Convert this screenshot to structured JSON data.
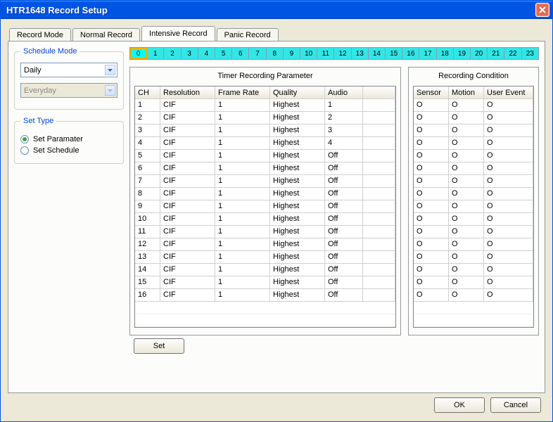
{
  "window": {
    "title": "HTR1648 Record Setup"
  },
  "tabs": [
    {
      "label": "Record Mode"
    },
    {
      "label": "Normal Record"
    },
    {
      "label": "Intensive Record"
    },
    {
      "label": "Panic Record"
    }
  ],
  "active_tab": 2,
  "schedule_mode": {
    "legend": "Schedule Mode",
    "primary_value": "Daily",
    "secondary_value": "Everyday",
    "secondary_disabled": true
  },
  "set_type": {
    "legend": "Set Type",
    "options": [
      {
        "label": "Set Paramater",
        "checked": true
      },
      {
        "label": "Set Schedule",
        "checked": false
      }
    ]
  },
  "hours": [
    "0",
    "1",
    "2",
    "3",
    "4",
    "5",
    "6",
    "7",
    "8",
    "9",
    "10",
    "11",
    "12",
    "13",
    "14",
    "15",
    "16",
    "17",
    "18",
    "19",
    "20",
    "21",
    "22",
    "23"
  ],
  "selected_hour": 0,
  "main_table": {
    "caption": "Timer Recording Parameter",
    "headers": [
      "CH",
      "Resolution",
      "Frame Rate",
      "Quality",
      "Audio",
      ""
    ],
    "rows": [
      [
        "1",
        "CIF",
        "1",
        "Highest",
        "1"
      ],
      [
        "2",
        "CIF",
        "1",
        "Highest",
        "2"
      ],
      [
        "3",
        "CIF",
        "1",
        "Highest",
        "3"
      ],
      [
        "4",
        "CIF",
        "1",
        "Highest",
        "4"
      ],
      [
        "5",
        "CIF",
        "1",
        "Highest",
        "Off"
      ],
      [
        "6",
        "CIF",
        "1",
        "Highest",
        "Off"
      ],
      [
        "7",
        "CIF",
        "1",
        "Highest",
        "Off"
      ],
      [
        "8",
        "CIF",
        "1",
        "Highest",
        "Off"
      ],
      [
        "9",
        "CIF",
        "1",
        "Highest",
        "Off"
      ],
      [
        "10",
        "CIF",
        "1",
        "Highest",
        "Off"
      ],
      [
        "11",
        "CIF",
        "1",
        "Highest",
        "Off"
      ],
      [
        "12",
        "CIF",
        "1",
        "Highest",
        "Off"
      ],
      [
        "13",
        "CIF",
        "1",
        "Highest",
        "Off"
      ],
      [
        "14",
        "CIF",
        "1",
        "Highest",
        "Off"
      ],
      [
        "15",
        "CIF",
        "1",
        "Highest",
        "Off"
      ],
      [
        "16",
        "CIF",
        "1",
        "Highest",
        "Off"
      ]
    ]
  },
  "cond_table": {
    "caption": "Recording Condition",
    "headers": [
      "Sensor",
      "Motion",
      "User Event"
    ],
    "rows": [
      [
        "O",
        "O",
        "O"
      ],
      [
        "O",
        "O",
        "O"
      ],
      [
        "O",
        "O",
        "O"
      ],
      [
        "O",
        "O",
        "O"
      ],
      [
        "O",
        "O",
        "O"
      ],
      [
        "O",
        "O",
        "O"
      ],
      [
        "O",
        "O",
        "O"
      ],
      [
        "O",
        "O",
        "O"
      ],
      [
        "O",
        "O",
        "O"
      ],
      [
        "O",
        "O",
        "O"
      ],
      [
        "O",
        "O",
        "O"
      ],
      [
        "O",
        "O",
        "O"
      ],
      [
        "O",
        "O",
        "O"
      ],
      [
        "O",
        "O",
        "O"
      ],
      [
        "O",
        "O",
        "O"
      ],
      [
        "O",
        "O",
        "O"
      ]
    ]
  },
  "buttons": {
    "set": "Set",
    "ok": "OK",
    "cancel": "Cancel"
  }
}
